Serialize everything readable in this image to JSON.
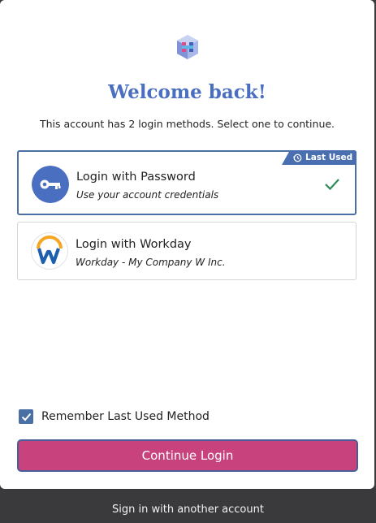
{
  "header": {
    "title": "Welcome back!",
    "subtitle": "This account has 2 login methods. Select one to continue."
  },
  "methods": [
    {
      "title": "Login with Password",
      "subtitle": "Use your account credentials",
      "icon": "key-icon",
      "badge": "Last Used",
      "selected": true
    },
    {
      "title": "Login with Workday",
      "subtitle": "Workday - My Company W Inc.",
      "icon": "workday-logo-icon",
      "selected": false
    }
  ],
  "remember": {
    "label": "Remember Last Used Method",
    "checked": true
  },
  "continue_label": "Continue Login",
  "footer_link": "Sign in with another account",
  "colors": {
    "accent": "#4a6fc1",
    "button": "#c8437e",
    "selected_border": "#4a6fa5",
    "check": "#2e8b57"
  }
}
